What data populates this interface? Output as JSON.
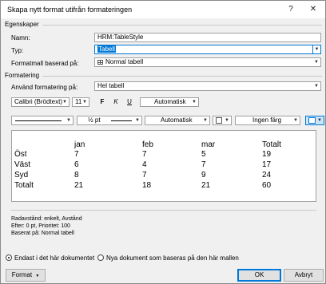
{
  "window": {
    "title": "Skapa nytt format utifrån formateringen",
    "help_label": "?",
    "close_label": "✕"
  },
  "properties": {
    "section_label": "Egenskaper",
    "name_label": "Namn:",
    "name_value": "HRM:TableStyle",
    "type_label": "Typ:",
    "type_value": "Tabell",
    "based_on_label": "Formatmall baserad på:",
    "based_on_value": "Normal tabell"
  },
  "formatting": {
    "section_label": "Formatering",
    "apply_to_label": "Använd formatering på:",
    "apply_to_value": "Hel tabell",
    "font_value": "Calibri (Brödtext)",
    "size_value": "11",
    "bold_label": "F",
    "italic_label": "K",
    "underline_label": "U",
    "font_color_value": "Automatisk",
    "border_weight_value": "½ pt",
    "border_color_value": "Automatisk",
    "shading_value": "Ingen färg"
  },
  "preview": {
    "header": [
      "",
      "jan",
      "feb",
      "mar",
      "Totalt"
    ],
    "rows": [
      [
        "Öst",
        "7",
        "7",
        "5",
        "19"
      ],
      [
        "Väst",
        "6",
        "4",
        "7",
        "17"
      ],
      [
        "Syd",
        "8",
        "7",
        "9",
        "24"
      ],
      [
        "Totalt",
        "21",
        "18",
        "21",
        "60"
      ]
    ]
  },
  "description": {
    "line1": "Radavstånd:  enkelt, Avstånd",
    "line2": "Efter:  0 pt, Prioritet: 100",
    "line3": "Baserat på: Normal tabell"
  },
  "options": {
    "only_this_doc_label": "Endast i det här dokumentet",
    "new_docs_label": "Nya dokument som baseras på den här mallen"
  },
  "footer": {
    "format_label": "Format",
    "ok_label": "OK",
    "cancel_label": "Avbryt"
  },
  "colors": {
    "accent": "#0078d7",
    "dialog_bg": "#f0f0f0"
  }
}
